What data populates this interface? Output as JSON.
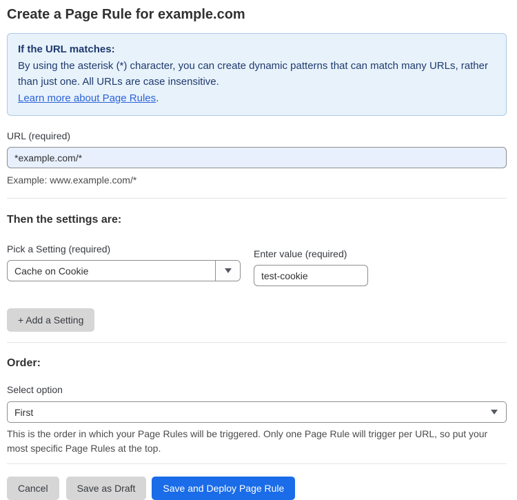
{
  "page": {
    "title": "Create a Page Rule for example.com"
  },
  "info_box": {
    "heading": "If the URL matches:",
    "body": "By using the asterisk (*) character, you can create dynamic patterns that can match many URLs, rather than just one. All URLs are case insensitive.",
    "link": "Learn more about Page Rules",
    "link_suffix": "."
  },
  "url_field": {
    "label": "URL (required)",
    "value": "*example.com/*",
    "helper": "Example: www.example.com/*"
  },
  "settings_section": {
    "heading": "Then the settings are:",
    "setting_select": {
      "label": "Pick a Setting (required)",
      "value": "Cache on Cookie"
    },
    "value_field": {
      "label": "Enter value (required)",
      "value": "test-cookie"
    },
    "add_setting_button": "+ Add a Setting"
  },
  "order_section": {
    "heading": "Order:",
    "select_label": "Select option",
    "select_value": "First",
    "helper": "This is the order in which your Page Rules will be triggered. Only one Page Rule will trigger per URL, so put your most specific Page Rules at the top."
  },
  "footer": {
    "cancel_label": "Cancel",
    "save_draft_label": "Save as Draft",
    "save_deploy_label": "Save and Deploy Page Rule"
  },
  "colors": {
    "info_bg": "#e8f2fb",
    "info_border": "#a9cbe8",
    "info_text": "#1e3a6e",
    "link": "#2c62d9",
    "url_input_bg": "#e8f0fe",
    "primary_button": "#1a6ce8",
    "secondary_button": "#d6d6d6"
  }
}
